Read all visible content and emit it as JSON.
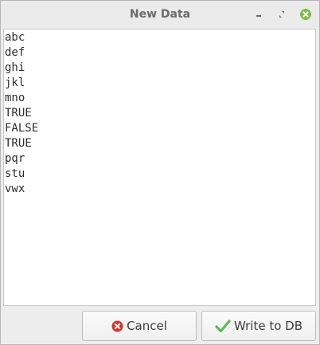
{
  "window": {
    "title": "New Data",
    "controls": [
      "minimize-icon",
      "maximize-icon",
      "close-icon"
    ],
    "close_color": "#7fbd3f"
  },
  "text_area": {
    "lines": [
      "abc",
      "def",
      "ghi",
      "jkl",
      "mno",
      "TRUE",
      "FALSE",
      "TRUE",
      "pqr",
      "stu",
      "vwx"
    ]
  },
  "footer": {
    "cancel_label": "Cancel",
    "cancel_icon": "cancel-icon",
    "cancel_icon_color": "#d9342b",
    "write_label": "Write to DB",
    "write_icon": "check-icon",
    "write_icon_color": "#5cb85c"
  }
}
